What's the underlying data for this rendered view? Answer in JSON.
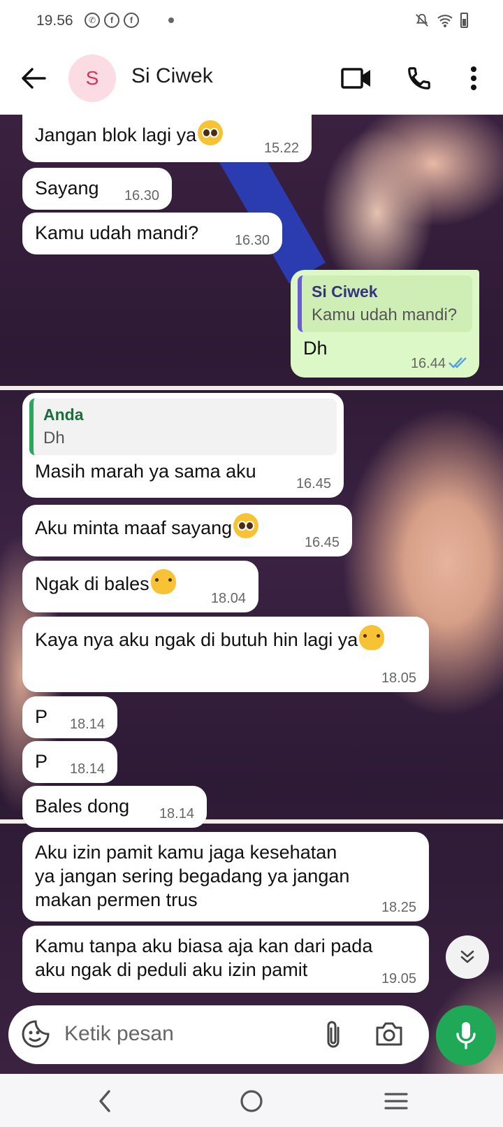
{
  "status_bar": {
    "time": "19.56",
    "app_icons": [
      "whatsapp-icon",
      "facebook-icon",
      "facebook-icon"
    ],
    "right_icons": [
      "mute-icon",
      "wifi-icon",
      "battery-icon"
    ]
  },
  "header": {
    "avatar_letter": "S",
    "contact_name": "Si Ciwek"
  },
  "messages": [
    {
      "text": "Jangan blok lagi ya",
      "time": "15.22",
      "emoji": "pleading-face"
    },
    {
      "text": "Sayang",
      "time": "16.30"
    },
    {
      "text": "Kamu udah mandi?",
      "time": "16.30"
    },
    {
      "outgoing": true,
      "quote_name": "Si Ciwek",
      "quote_text": "Kamu udah mandi?",
      "text": "Dh",
      "time": "16.44",
      "status": "read"
    },
    {
      "quote_name": "Anda",
      "quote_text": "Dh",
      "text": "Masih marah ya sama aku",
      "time": "16.45"
    },
    {
      "text": "Aku minta maaf sayang",
      "time": "16.45",
      "emoji": "pleading-face"
    },
    {
      "text": "Ngak di bales",
      "time": "18.04",
      "emoji": "melting-face"
    },
    {
      "text": "Kaya nya aku ngak di butuh hin lagi ya",
      "time": "18.05",
      "emoji": "melting-face"
    },
    {
      "text": "P",
      "time": "18.14"
    },
    {
      "text": "P",
      "time": "18.14"
    },
    {
      "text": "Bales dong",
      "time": "18.14"
    },
    {
      "text_lines": [
        "Aku izin pamit kamu jaga kesehatan",
        "ya jangan sering begadang ya jangan",
        "makan permen trus"
      ],
      "time": "18.25"
    },
    {
      "text_lines": [
        "Kamu tanpa aku biasa aja kan dari pada",
        "aku ngak di peduli aku izin pamit"
      ],
      "time": "19.05"
    }
  ],
  "input": {
    "placeholder": "Ketik pesan"
  },
  "colors": {
    "accent_green": "#1fa855",
    "outgoing_bubble": "#dcf8c6",
    "read_ticks": "#4fa3e3",
    "avatar_bg": "#fbdce3",
    "avatar_letter": "#d9335e"
  }
}
